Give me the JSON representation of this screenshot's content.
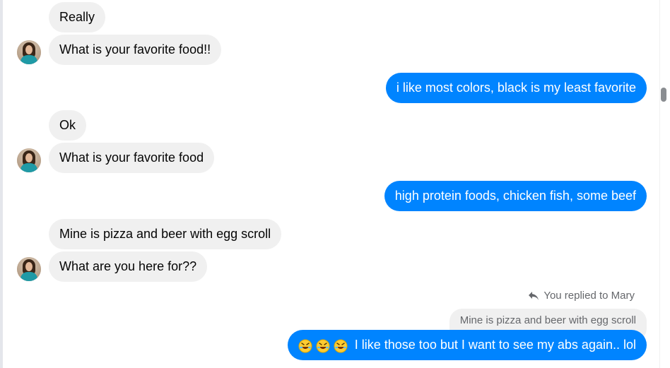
{
  "messages": {
    "m1": "Really",
    "m2": "What is your favorite food!!",
    "m3": "i like most colors, black is my least favorite",
    "m4": "Ok",
    "m5": "What is your favorite food",
    "m6": "high protein foods,  chicken fish, some beef",
    "m7": "Mine is pizza and beer with egg scroll",
    "m8": "What are you here for??",
    "m9": "I like those too but I want to see my abs again.. lol"
  },
  "reply": {
    "note": "You replied to Mary",
    "quoted": "Mine is pizza and beer with egg scroll"
  },
  "icons": {
    "reply": "reply-arrow-icon",
    "emoji": "rolling-on-floor-laughing-emoji"
  },
  "colors": {
    "outgoing": "#0084ff",
    "incoming": "#f0f0f0",
    "meta_text": "#65676b"
  }
}
